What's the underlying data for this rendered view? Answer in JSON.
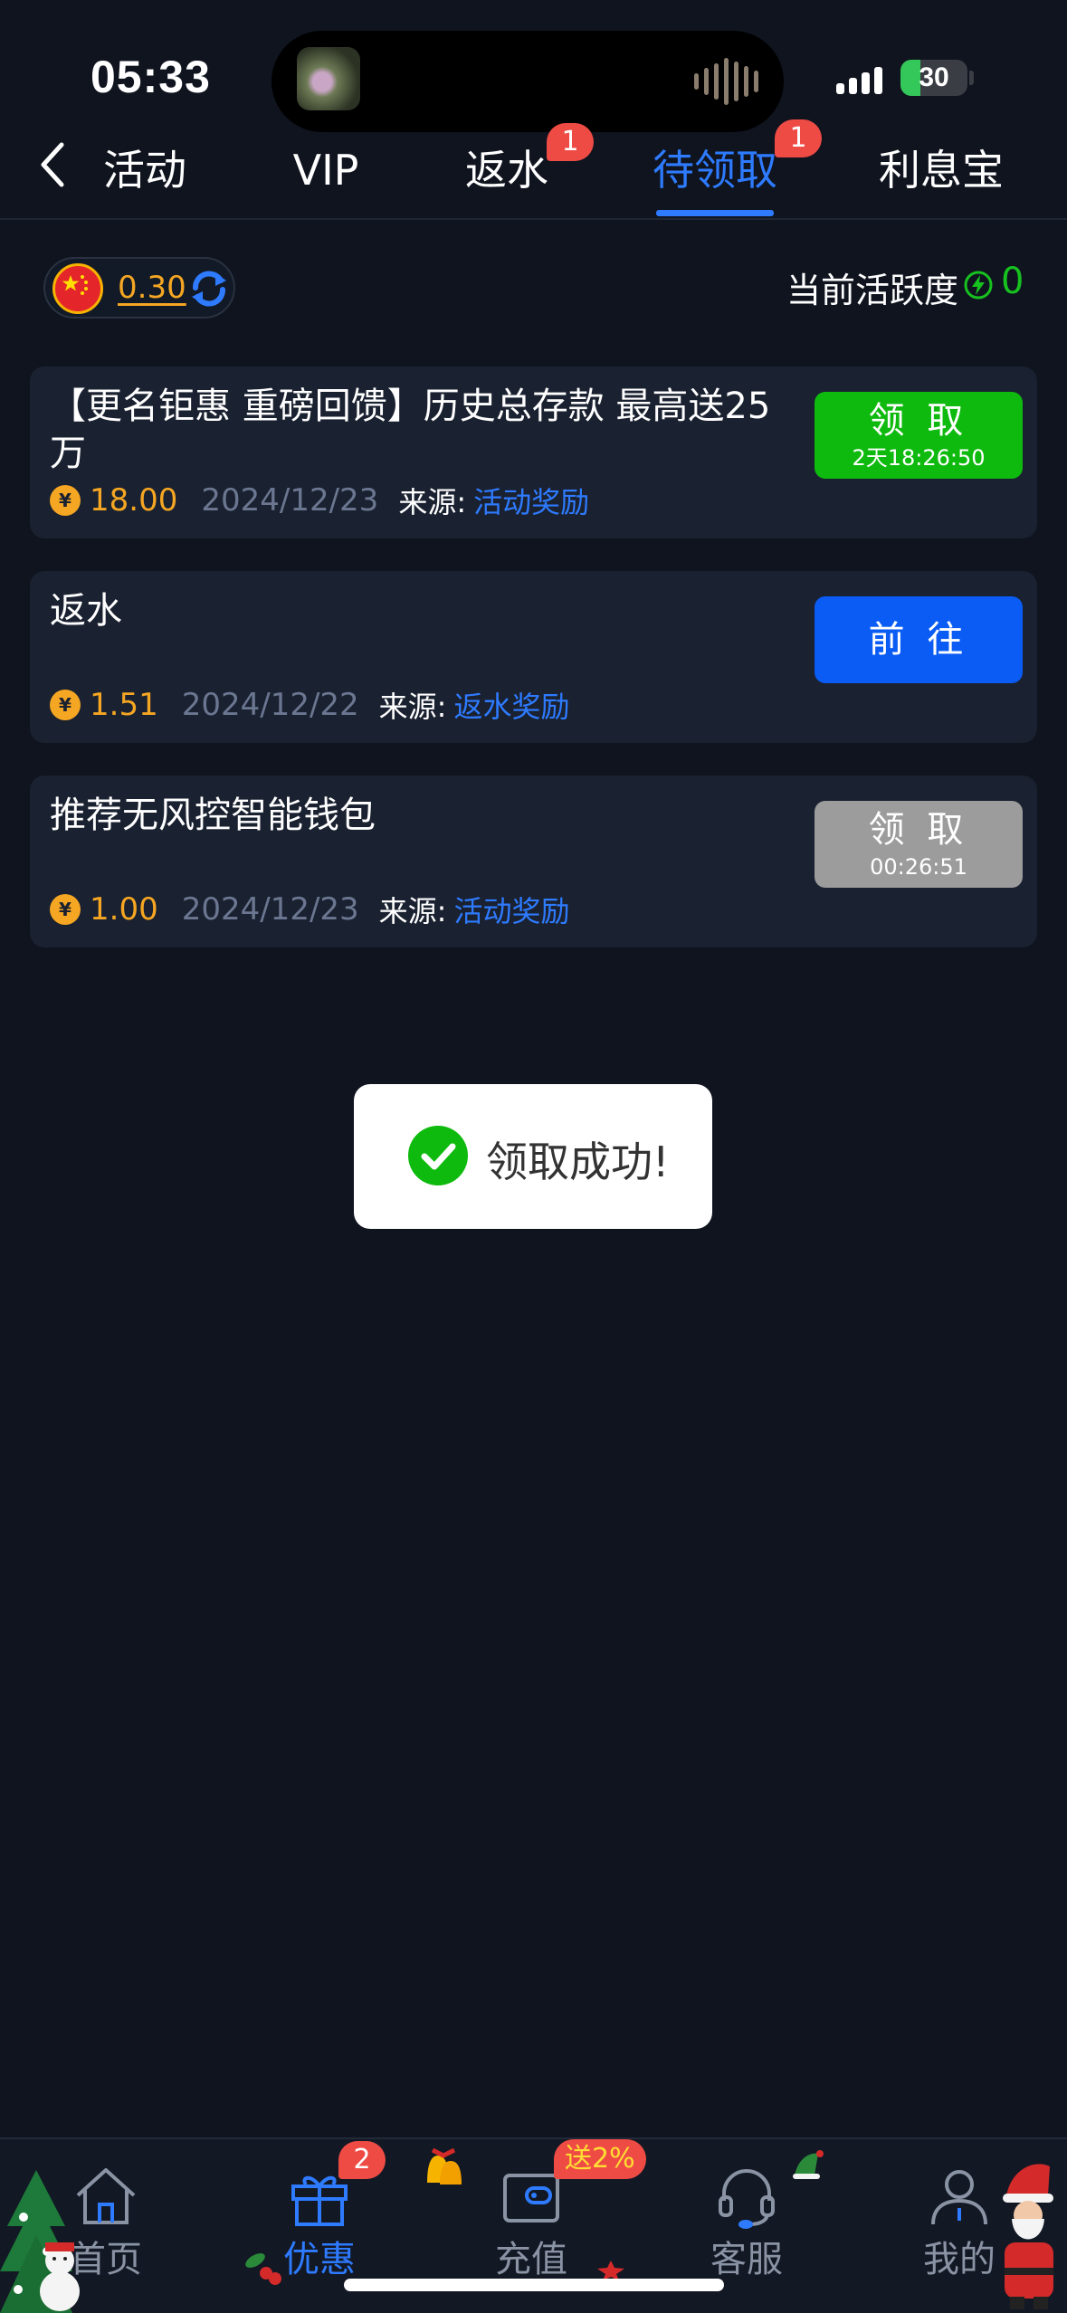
{
  "status_bar": {
    "time": "05:33",
    "battery_level": "30",
    "battery_fraction": 0.3
  },
  "tabs": [
    {
      "label": "活动",
      "active": false
    },
    {
      "label": "VIP",
      "active": false
    },
    {
      "label": "返水",
      "active": false,
      "badge": "1"
    },
    {
      "label": "待领取",
      "active": true,
      "badge": "1"
    },
    {
      "label": "利息宝",
      "active": false
    }
  ],
  "balance": {
    "value": "0.30",
    "activity_label": "当前活跃度",
    "activity_value": "0"
  },
  "rewards": [
    {
      "title": "【更名钜惠 重磅回馈】历史总存款 最高送25万",
      "currency_symbol": "¥",
      "amount": "18.00",
      "date": "2024/12/23",
      "source_label": "来源:",
      "source": "活动奖励",
      "button": {
        "label": "领 取",
        "sublabel": "2天18:26:50",
        "style": "green"
      }
    },
    {
      "title": "返水",
      "currency_symbol": "¥",
      "amount": "1.51",
      "date": "2024/12/22",
      "source_label": "来源:",
      "source": "返水奖励",
      "button": {
        "label": "前 往",
        "sublabel": "",
        "style": "blue"
      }
    },
    {
      "title": "推荐无风控智能钱包",
      "currency_symbol": "¥",
      "amount": "1.00",
      "date": "2024/12/23",
      "source_label": "来源:",
      "source": "活动奖励",
      "button": {
        "label": "领 取",
        "sublabel": "00:26:51",
        "style": "grey"
      }
    }
  ],
  "toast": {
    "message": "领取成功!"
  },
  "bottom_nav": {
    "items": [
      {
        "label": "首页",
        "icon": "home-icon",
        "active": false
      },
      {
        "label": "优惠",
        "icon": "gift-icon",
        "active": true,
        "badge": "2"
      },
      {
        "label": "充值",
        "icon": "wallet-icon",
        "active": false
      },
      {
        "label": "客服",
        "icon": "headset-icon",
        "active": false
      },
      {
        "label": "我的",
        "icon": "user-icon",
        "active": false
      }
    ],
    "promo_badge": "送2%"
  },
  "colors": {
    "background": "#0f141f",
    "accent": "#2e7bff",
    "gold": "#f5a623",
    "green": "#0fba0f",
    "badge_red": "#ef4b45"
  }
}
